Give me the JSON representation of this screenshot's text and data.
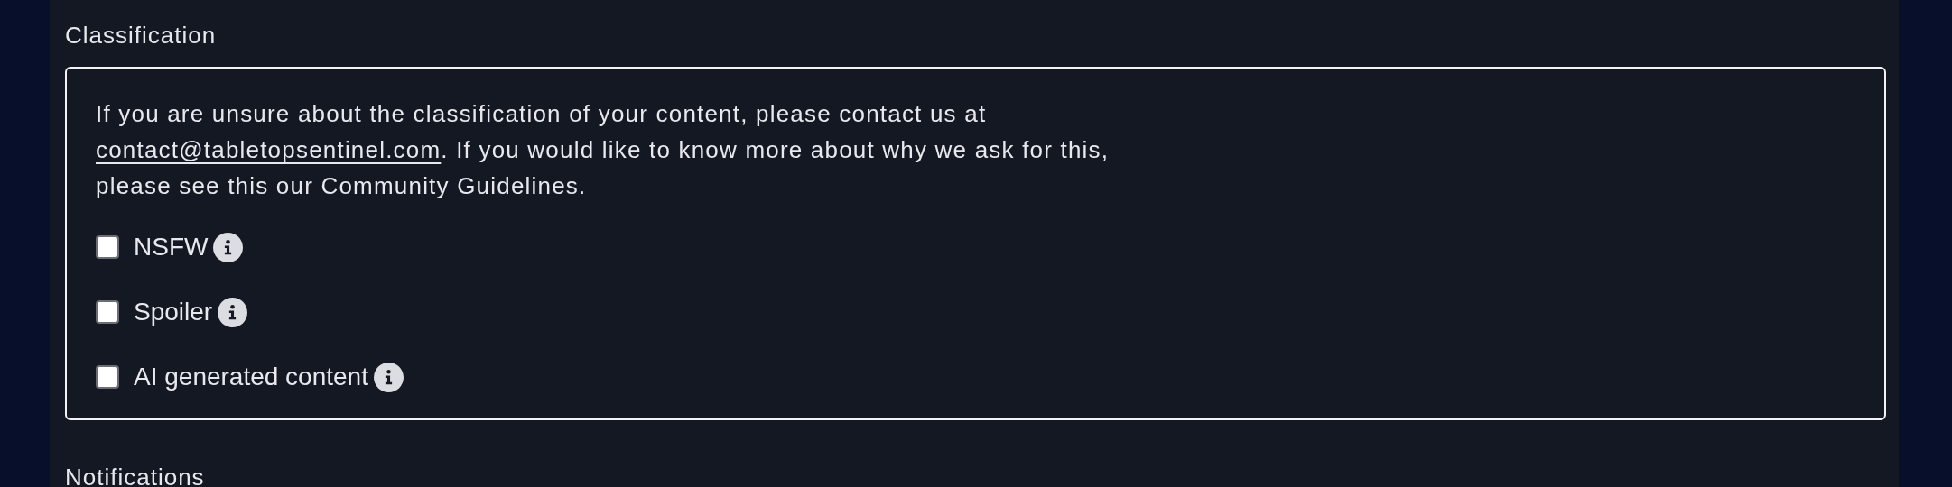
{
  "section": {
    "title": "Classification",
    "intro": {
      "before": "If you are unsure about the classification of your content, please contact us at ",
      "link": "contact@tabletopsentinel.com",
      "after": ". If you would like to know more about why we ask for this, please see this our Community Guidelines."
    },
    "options": [
      {
        "label": "NSFW",
        "checked": false
      },
      {
        "label": "Spoiler",
        "checked": false
      },
      {
        "label": "AI generated content",
        "checked": false
      }
    ]
  },
  "next_section": {
    "title": "Notifications"
  }
}
